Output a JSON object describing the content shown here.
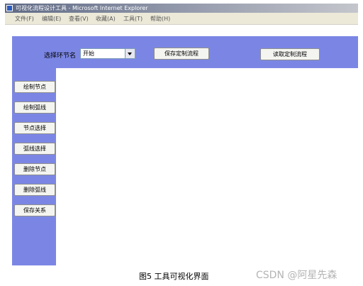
{
  "window": {
    "title": "可视化流程设计工具 - Microsoft Internet Explorer"
  },
  "menu": [
    "文件(F)",
    "编辑(E)",
    "查看(V)",
    "收藏(A)",
    "工具(T)",
    "帮助(H)"
  ],
  "toolbar": {
    "step_label": "选择环节名",
    "step_select_value": "开始",
    "save_flow_button": "保存定制流程",
    "load_flow_button": "读取定制流程"
  },
  "sidebar": {
    "items": [
      {
        "label": "绘制节点"
      },
      {
        "label": "绘制弧线"
      },
      {
        "label": "节点选择"
      },
      {
        "label": "弧线选择"
      },
      {
        "label": "删除节点"
      },
      {
        "label": "删除弧线"
      },
      {
        "label": "保存关系"
      }
    ]
  },
  "caption": "图5  工具可视化界面",
  "watermark": "CSDN @阿星先森",
  "colors": {
    "panel": "#7b86e4",
    "titlebar": "#5f6a85"
  }
}
